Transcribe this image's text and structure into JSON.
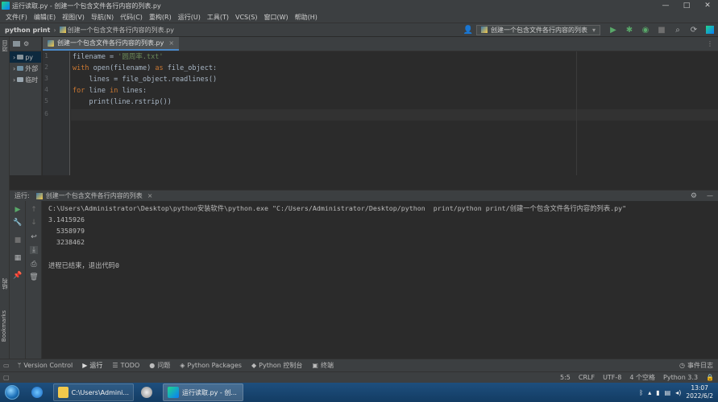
{
  "window": {
    "title": "运行读取.py - 创建一个包含文件各行内容的列表.py",
    "controls": [
      "—",
      "□",
      "✕"
    ]
  },
  "menu": [
    "文件(F)",
    "编辑(E)",
    "视图(V)",
    "导航(N)",
    "代码(C)",
    "重构(R)",
    "运行(U)",
    "工具(T)",
    "VCS(S)",
    "窗口(W)",
    "帮助(H)"
  ],
  "navbar": {
    "project": "python print",
    "file": "创建一个包含文件各行内容的列表.py",
    "run_config": "创建一个包含文件各行内容的列表"
  },
  "project_panel": {
    "rows": [
      "py",
      "外部",
      "临时"
    ]
  },
  "editor": {
    "tab_label": "创建一个包含文件各行内容的列表.py",
    "line_numbers": [
      "1",
      "2",
      "3",
      "4",
      "5",
      "6"
    ],
    "code": [
      {
        "tokens": [
          {
            "t": "filename = ",
            "c": "fn"
          },
          {
            "t": "'圆周率.txt'",
            "c": "str"
          }
        ]
      },
      {
        "tokens": [
          {
            "t": "with ",
            "c": "kw"
          },
          {
            "t": "open(filename) ",
            "c": "fn"
          },
          {
            "t": "as ",
            "c": "kw"
          },
          {
            "t": "file_object:",
            "c": "fn"
          }
        ]
      },
      {
        "tokens": [
          {
            "t": "    lines = file_object.readlines()",
            "c": "fn"
          }
        ]
      },
      {
        "tokens": [
          {
            "t": "for ",
            "c": "kw"
          },
          {
            "t": "line ",
            "c": "fn"
          },
          {
            "t": "in ",
            "c": "kw"
          },
          {
            "t": "lines:",
            "c": "fn"
          }
        ]
      },
      {
        "tokens": [
          {
            "t": "    print(line.rstrip())",
            "c": "fn"
          }
        ]
      },
      {
        "tokens": []
      }
    ]
  },
  "run_panel": {
    "label": "运行:",
    "tab_label": "创建一个包含文件各行内容的列表",
    "console": [
      "C:\\Users\\Administrator\\Desktop\\python安装软件\\python.exe \"C:/Users/Administrator/Desktop/python  print/python print/创建一个包含文件各行内容的列表.py\"",
      "3.1415926",
      "  5358979",
      "  3238462",
      "",
      "进程已结束，退出代码0"
    ]
  },
  "tool_windows": [
    {
      "icon": "branch-icon",
      "glyph": "ᛘ",
      "label": "Version Control"
    },
    {
      "icon": "run-icon",
      "glyph": "▶",
      "label": "运行"
    },
    {
      "icon": "todo-icon",
      "glyph": "☰",
      "label": "TODO"
    },
    {
      "icon": "problems-icon",
      "glyph": "●",
      "label": "问题"
    },
    {
      "icon": "packages-icon",
      "glyph": "◈",
      "label": "Python Packages"
    },
    {
      "icon": "python-console-icon",
      "glyph": "◆",
      "label": "Python 控制台"
    },
    {
      "icon": "terminal-icon",
      "glyph": "▣",
      "label": "终端"
    }
  ],
  "event_log": "事件日志",
  "status": {
    "position": "5:5",
    "line_sep": "CRLF",
    "encoding": "UTF-8",
    "indent": "4 个空格",
    "interpreter": "Python 3.3"
  },
  "left_stripe": {
    "project": "项目",
    "structure": "结构",
    "bookmarks": "Bookmarks"
  },
  "taskbar": {
    "explorer_label": "C:\\Users\\Admini...",
    "pycharm_label": "运行读取.py - 创...",
    "time": "13:07",
    "date": "2022/6/2"
  },
  "colors": {
    "keyword": "#cc7832",
    "string": "#6a8759",
    "text": "#a9b7c6",
    "run_green": "#59a869"
  }
}
